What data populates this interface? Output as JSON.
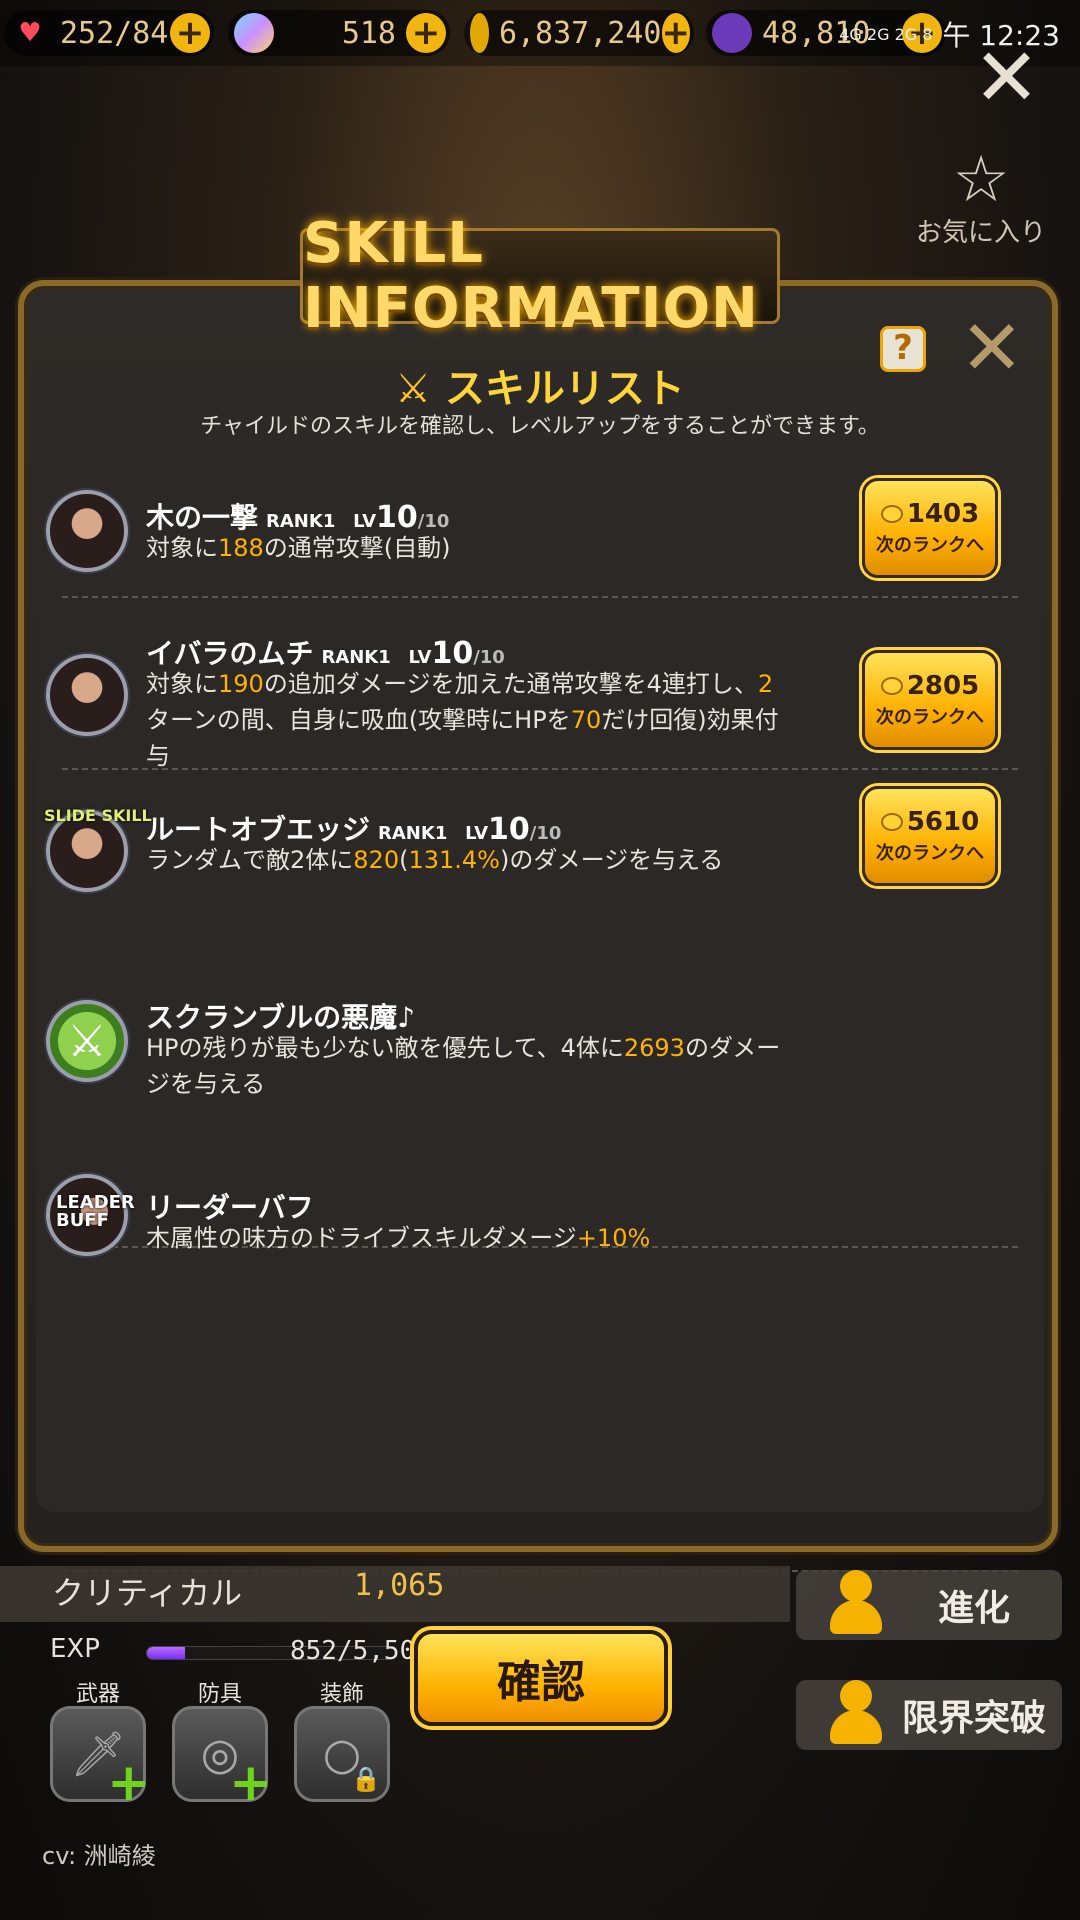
{
  "status_bar": {
    "stamina": "252/84",
    "gems": "518",
    "coins": "6,837,240",
    "other": "48,810",
    "time": "午 12:23",
    "network": "4G 2G 2G 8"
  },
  "favorite_label": "お気に入り",
  "panel": {
    "title": "SKILL INFORMATION",
    "help_label": "?",
    "list_title": "スキルリスト",
    "subtitle": "チャイルドのスキルを確認し、レベルアップをすることができます。"
  },
  "skills": [
    {
      "name": "木の一撃",
      "rank": "RANK1",
      "lv_label": "LV",
      "lv": "10",
      "lv_max": "/10",
      "desc": [
        "対象に",
        "188",
        "の通常攻撃(自動)"
      ],
      "cost": "1403",
      "button": "次のランクへ"
    },
    {
      "name": "イバラのムチ",
      "rank": "RANK1",
      "lv_label": "LV",
      "lv": "10",
      "lv_max": "/10",
      "desc_line1": [
        "対象に",
        "190",
        "の追加ダメージを加えた通常攻撃を4連打し、",
        "2"
      ],
      "desc_line2": [
        "ターンの間、自身に吸血(攻撃時にHPを",
        "70",
        "だけ回復)効果付"
      ],
      "desc_line3": "与",
      "cost": "2805",
      "button": "次のランクへ"
    },
    {
      "name": "ルートオブエッジ",
      "rank": "RANK1",
      "lv_label": "LV",
      "lv": "10",
      "lv_max": "/10",
      "badge": "SLIDE SKILL",
      "desc": [
        "ランダムで敵2体に",
        "820",
        "(",
        "131.4%",
        ")のダメージを与える"
      ],
      "cost": "5610",
      "button": "次のランクへ"
    },
    {
      "name": "スクランブルの悪魔♪",
      "desc_line1": [
        "HPの残りが最も少ない敵を優先して、4体に",
        "2693",
        "のダメー"
      ],
      "desc_line2": "ジを与える"
    },
    {
      "name": "リーダーバフ",
      "badge": "LEADER BUFF",
      "desc": [
        "木属性の味方のドライブスキルダメージ",
        "+10%"
      ]
    }
  ],
  "stats": {
    "critical_label": "クリティカル",
    "critical_value": "1,065",
    "exp_label": "EXP",
    "exp_value": "852/5,503",
    "exp_fraction": 0.155
  },
  "confirm_label": "確認",
  "equipment": [
    {
      "label": "武器"
    },
    {
      "label": "防具"
    },
    {
      "label": "装飾"
    }
  ],
  "side_buttons": {
    "evolve": "進化",
    "limit_break": "限界突破"
  },
  "cv_label": "cv: 洲崎綾",
  "colors": {
    "accent_gold": "#ffb300",
    "highlight_text": "#ffb300",
    "panel_border": "#8a6a2a"
  }
}
